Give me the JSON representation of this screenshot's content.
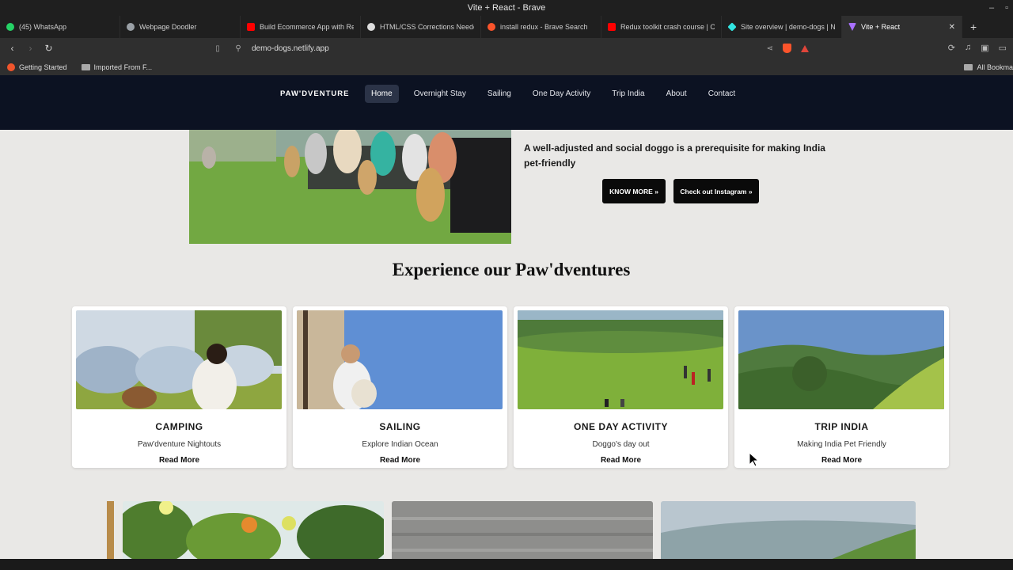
{
  "window": {
    "title": "Vite + React - Brave"
  },
  "tabs": [
    {
      "title": "(45) WhatsApp",
      "favicon_color": "#25d366"
    },
    {
      "title": "Webpage Doodler",
      "favicon_color": "#9aa0a6"
    },
    {
      "title": "Build Ecommerce App with Re",
      "favicon_color": "#ff0000"
    },
    {
      "title": "HTML/CSS Corrections Neede",
      "favicon_color": "#dddddd"
    },
    {
      "title": "install redux - Brave Search",
      "favicon_color": "#fb542b"
    },
    {
      "title": "Redux toolkit crash course | C",
      "favicon_color": "#ff0000"
    },
    {
      "title": "Site overview | demo-dogs | N",
      "favicon_color": "#32e6e2"
    },
    {
      "title": "Vite + React",
      "favicon_color": "#a970ff",
      "active": true
    }
  ],
  "address_bar": {
    "url": "demo-dogs.netlify.app"
  },
  "bookmarks": {
    "items": [
      "Getting Started",
      "Imported From F..."
    ],
    "right_label": "All Bookma"
  },
  "site": {
    "logo": "PAW'DVENTURE",
    "nav": [
      {
        "label": "Home",
        "active": true
      },
      {
        "label": "Overnight Stay"
      },
      {
        "label": "Sailing"
      },
      {
        "label": "One Day Activity"
      },
      {
        "label": "Trip India"
      },
      {
        "label": "About"
      },
      {
        "label": "Contact"
      }
    ],
    "hero": {
      "text": "A well-adjusted and social doggo is a prerequisite for making India pet-friendly",
      "know_more": "KNOW MORE »",
      "instagram": "Check out Instagram »"
    },
    "section_title": "Experience our Paw'dventures",
    "cards": [
      {
        "title": "CAMPING",
        "subtitle": "Paw'dventure Nightouts",
        "link": "Read More"
      },
      {
        "title": "SAILING",
        "subtitle": "Explore Indian Ocean",
        "link": "Read More"
      },
      {
        "title": "ONE DAY ACTIVITY",
        "subtitle": "Doggo's day out",
        "link": "Read More"
      },
      {
        "title": "TRIP INDIA",
        "subtitle": "Making India Pet Friendly",
        "link": "Read More"
      }
    ]
  },
  "colors": {
    "nav_bg": "#0c1222",
    "page_bg": "#e9e8e6",
    "button_bg": "#0a0a0a"
  }
}
